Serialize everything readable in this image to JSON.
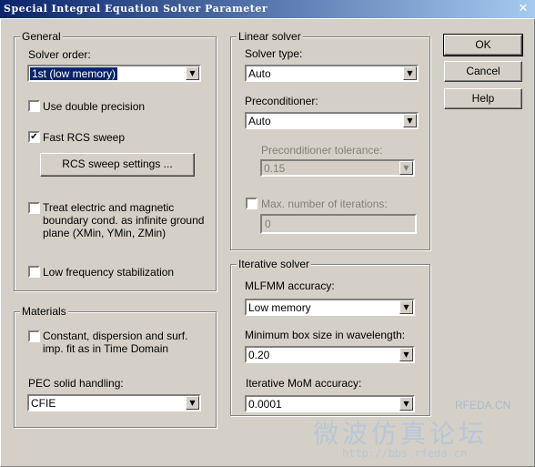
{
  "window": {
    "title": "Special Integral Equation Solver Parameter",
    "close_glyph": "✕"
  },
  "general": {
    "legend": "General",
    "solver_order_label": "Solver order:",
    "solver_order_value": "1st (low memory)",
    "use_double_precision": {
      "label": "Use double precision",
      "checked": false
    },
    "fast_rcs_sweep": {
      "label": "Fast RCS sweep",
      "checked": true
    },
    "rcs_sweep_settings_button": "RCS sweep settings ...",
    "treat_boundary": {
      "label_line1": "Treat electric and magnetic",
      "label_line2": "boundary cond. as infinite ground",
      "label_line3": "plane (XMin, YMin, ZMin)",
      "checked": false
    },
    "low_freq_stabilization": {
      "label": "Low frequency stabilization",
      "checked": false
    }
  },
  "materials": {
    "legend": "Materials",
    "constant_dispersion": {
      "label_line1": "Constant, dispersion and surf.",
      "label_line2": "imp. fit as in Time Domain",
      "checked": false
    },
    "pec_label": "PEC solid handling:",
    "pec_value": "CFIE"
  },
  "linear_solver": {
    "legend": "Linear solver",
    "solver_type_label": "Solver type:",
    "solver_type_value": "Auto",
    "preconditioner_label": "Preconditioner:",
    "preconditioner_value": "Auto",
    "precond_tol_label": "Preconditioner tolerance:",
    "precond_tol_value": "0.15",
    "max_iterations": {
      "label": "Max. number of iterations:",
      "checked": false
    },
    "max_iterations_value": "0"
  },
  "iterative_solver": {
    "legend": "Iterative solver",
    "mlfmm_label": "MLFMM accuracy:",
    "mlfmm_value": "Low memory",
    "min_box_label": "Minimum box size in wavelength:",
    "min_box_value": "0.20",
    "mom_label": "Iterative MoM accuracy:",
    "mom_value": "0.0001"
  },
  "buttons": {
    "ok": "OK",
    "cancel": "Cancel",
    "help": "Help"
  },
  "watermark": {
    "title": "微波仿真论坛",
    "url": "http://bbs.rfeda.cn",
    "brand": "RFEDA.CN"
  },
  "glyphs": {
    "check": "✔",
    "dropdown": "▼"
  }
}
